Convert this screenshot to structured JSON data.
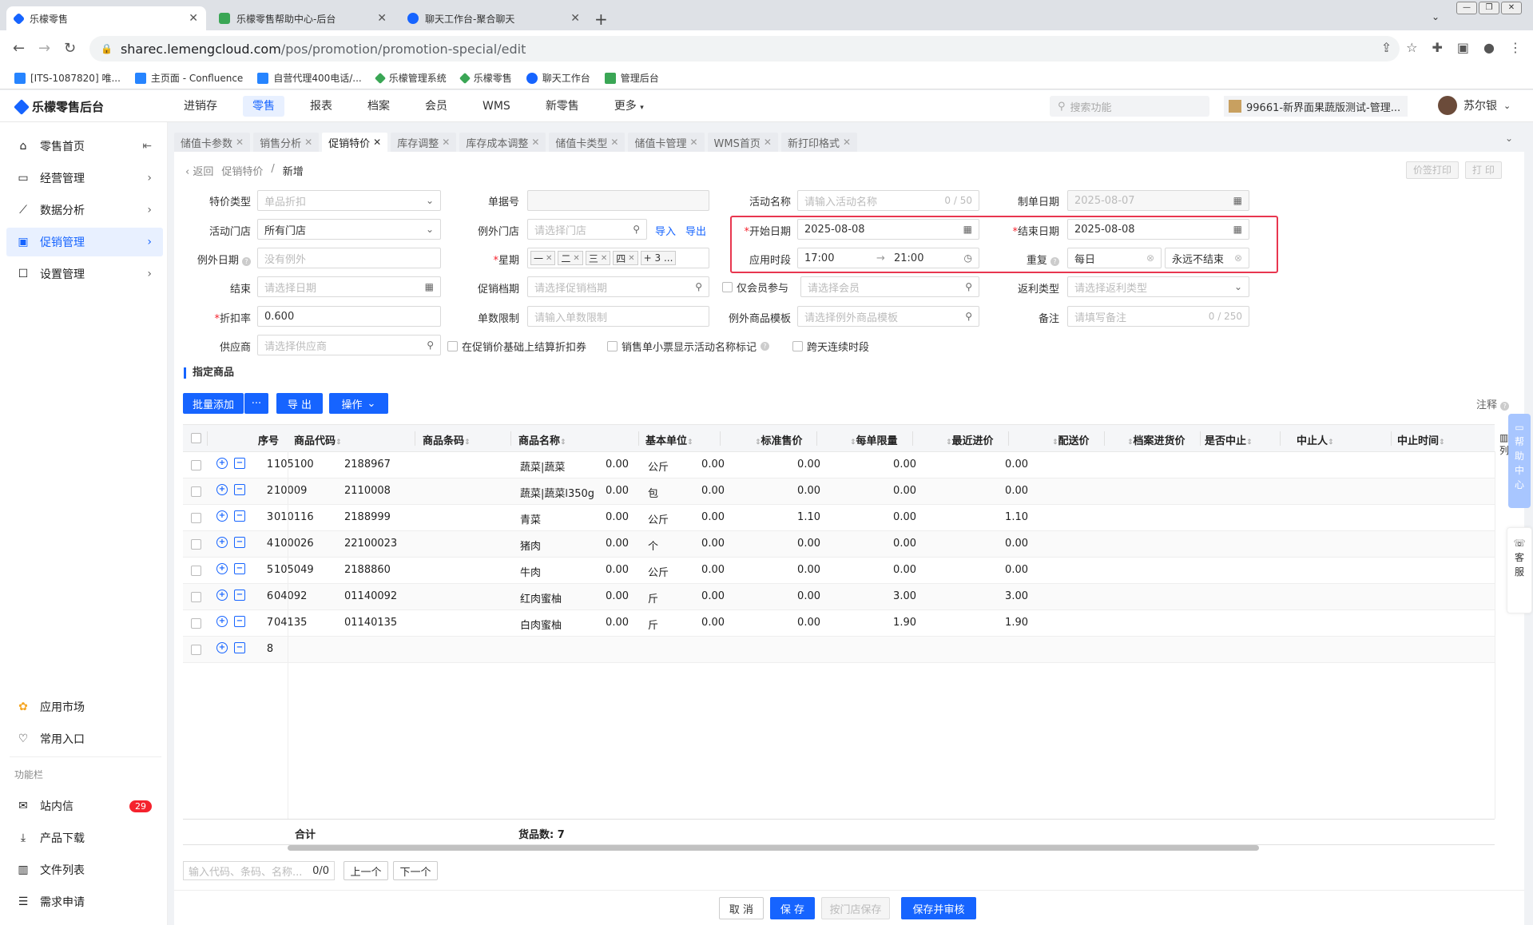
{
  "browser": {
    "tabs": [
      {
        "title": "乐檬零售",
        "active": true,
        "color": "#1664ff"
      },
      {
        "title": "乐檬零售帮助中心-后台",
        "active": false,
        "color": "#3aa655"
      },
      {
        "title": "聊天工作台-聚合聊天",
        "active": false,
        "color": "#1664ff"
      }
    ],
    "url_host": "sharec.lemengcloud.com",
    "url_path": "/pos/promotion/promotion-special/edit",
    "bookmarks": [
      "[ITS-1087820] 唯...",
      "主页面 - Confluence",
      "自营代理400电话/...",
      "乐檬管理系统",
      "乐檬零售",
      "聊天工作台",
      "管理后台"
    ]
  },
  "app": {
    "brand": "乐檬零售后台",
    "topnav": [
      "进销存",
      "零售",
      "报表",
      "档案",
      "会员",
      "WMS",
      "新零售",
      "更多"
    ],
    "topnav_active": 1,
    "search_placeholder": "搜索功能",
    "store": "99661-新界面果蔬版测试-管理...",
    "user": "苏尔银"
  },
  "sidebar": {
    "items": [
      {
        "label": "零售首页",
        "icon": "home-icon"
      },
      {
        "label": "经营管理",
        "icon": "monitor-icon"
      },
      {
        "label": "数据分析",
        "icon": "chart-icon"
      },
      {
        "label": "促销管理",
        "icon": "promo-icon",
        "active": true
      },
      {
        "label": "设置管理",
        "icon": "settings-icon"
      }
    ],
    "apps": [
      {
        "label": "应用市场",
        "icon": "app-market-icon"
      },
      {
        "label": "常用入口",
        "icon": "heart-icon"
      }
    ],
    "section_label": "功能栏",
    "func": [
      {
        "label": "站内信",
        "icon": "mail-icon",
        "badge": "29"
      },
      {
        "label": "产品下载",
        "icon": "download-icon"
      },
      {
        "label": "文件列表",
        "icon": "file-list-icon"
      },
      {
        "label": "需求申请",
        "icon": "request-icon"
      }
    ]
  },
  "pagetabs": [
    "储值卡参数",
    "销售分析",
    "促销特价",
    "库存调整",
    "库存成本调整",
    "储值卡类型",
    "储值卡管理",
    "WMS首页",
    "新打印格式"
  ],
  "pagetabs_active": 2,
  "breadcrumb": {
    "back": "返回",
    "parent": "促销特价",
    "current": "新增"
  },
  "top_buttons": {
    "price_print": "价签打印",
    "print": "打 印"
  },
  "form": {
    "special_type": {
      "label": "特价类型",
      "value": "单品折扣"
    },
    "doc_no": {
      "label": "单据号",
      "value": ""
    },
    "activity_name": {
      "label": "活动名称",
      "placeholder": "请输入活动名称",
      "count": "0 / 50"
    },
    "make_date": {
      "label": "制单日期",
      "value": "2025-08-07"
    },
    "activity_store": {
      "label": "活动门店",
      "value": "所有门店"
    },
    "except_store": {
      "label": "例外门店",
      "placeholder": "请选择门店",
      "import": "导入",
      "export": "导出"
    },
    "start_date": {
      "label": "开始日期",
      "value": "2025-08-08"
    },
    "end_date": {
      "label": "结束日期",
      "value": "2025-08-08"
    },
    "except_date": {
      "label": "例外日期",
      "placeholder": "没有例外"
    },
    "weekday": {
      "label": "星期",
      "tags": [
        "一",
        "二",
        "三",
        "四"
      ],
      "more": "+ 3 ..."
    },
    "apply_period": {
      "label": "应用时段",
      "from": "17:00",
      "arrow": "→",
      "to": "21:00"
    },
    "repeat": {
      "label": "重复",
      "value": "每日",
      "until": "永远不结束"
    },
    "finish": {
      "label": "结束",
      "placeholder": "请选择日期"
    },
    "promo_file": {
      "label": "促销档期",
      "placeholder": "请选择促销档期"
    },
    "member_only": {
      "label": "仅会员参与",
      "placeholder": "请选择会员"
    },
    "rebate_type": {
      "label": "返利类型",
      "placeholder": "请选择返利类型"
    },
    "discount": {
      "label": "折扣率",
      "value": "0.600"
    },
    "qty_limit": {
      "label": "单数限制",
      "placeholder": "请输入单数限制"
    },
    "except_template": {
      "label": "例外商品模板",
      "placeholder": "请选择例外商品模板"
    },
    "remark": {
      "label": "备注",
      "placeholder": "请填写备注",
      "count": "0 / 250"
    },
    "supplier": {
      "label": "供应商",
      "placeholder": "请选择供应商"
    },
    "check1": "在促销价基础上结算折扣券",
    "check2": "销售单小票显示活动名称标记",
    "check3": "跨天连续时段"
  },
  "section": {
    "title": "指定商品",
    "batch_add": "批量添加",
    "more": "···",
    "export": "导 出",
    "ops": "操作",
    "note": "注释"
  },
  "table": {
    "headers": [
      "序号",
      "商品代码",
      "商品条码",
      "商品名称",
      "基本单位",
      "标准售价",
      "每单限量",
      "最近进价",
      "配送价",
      "档案进货价",
      "是否中止",
      "中止人",
      "中止时间"
    ],
    "rows": [
      [
        "1",
        "105100",
        "2188967",
        "蔬菜|蔬菜",
        "公斤",
        "0.00",
        "0.00",
        "0.00",
        "0.00",
        "0.00"
      ],
      [
        "2",
        "10009",
        "2110008",
        "蔬菜|蔬菜l350g",
        "包",
        "0.00",
        "0.00",
        "0.00",
        "0.00",
        "0.00"
      ],
      [
        "3",
        "010116",
        "2188999",
        "青菜",
        "公斤",
        "0.00",
        "0.00",
        "1.10",
        "0.00",
        "1.10"
      ],
      [
        "4",
        "100026",
        "22100023",
        "猪肉",
        "个",
        "0.00",
        "0.00",
        "0.00",
        "0.00",
        "0.00"
      ],
      [
        "5",
        "105049",
        "2188860",
        "牛肉",
        "公斤",
        "0.00",
        "0.00",
        "0.00",
        "0.00",
        "0.00"
      ],
      [
        "6",
        "04092",
        "01140092",
        "红肉蜜柚",
        "斤",
        "0.00",
        "0.00",
        "0.00",
        "3.00",
        "3.00"
      ],
      [
        "7",
        "04135",
        "01140135",
        "白肉蜜柚",
        "斤",
        "0.00",
        "0.00",
        "0.00",
        "1.90",
        "1.90"
      ],
      [
        "8",
        "",
        "",
        "",
        "",
        "",
        "",
        "",
        "",
        ""
      ]
    ],
    "total_label": "合计",
    "goods_count": "货品数: 7"
  },
  "bottom": {
    "search_placeholder": "输入代码、条码、名称...",
    "search_count": "0/0",
    "prev": "上一个",
    "next": "下一个"
  },
  "footer": {
    "cancel": "取 消",
    "save": "保 存",
    "store_save": "按门店保存",
    "save_audit": "保存并审核"
  },
  "float": {
    "help": "帮助中心",
    "service": "客服",
    "columns": "列"
  }
}
